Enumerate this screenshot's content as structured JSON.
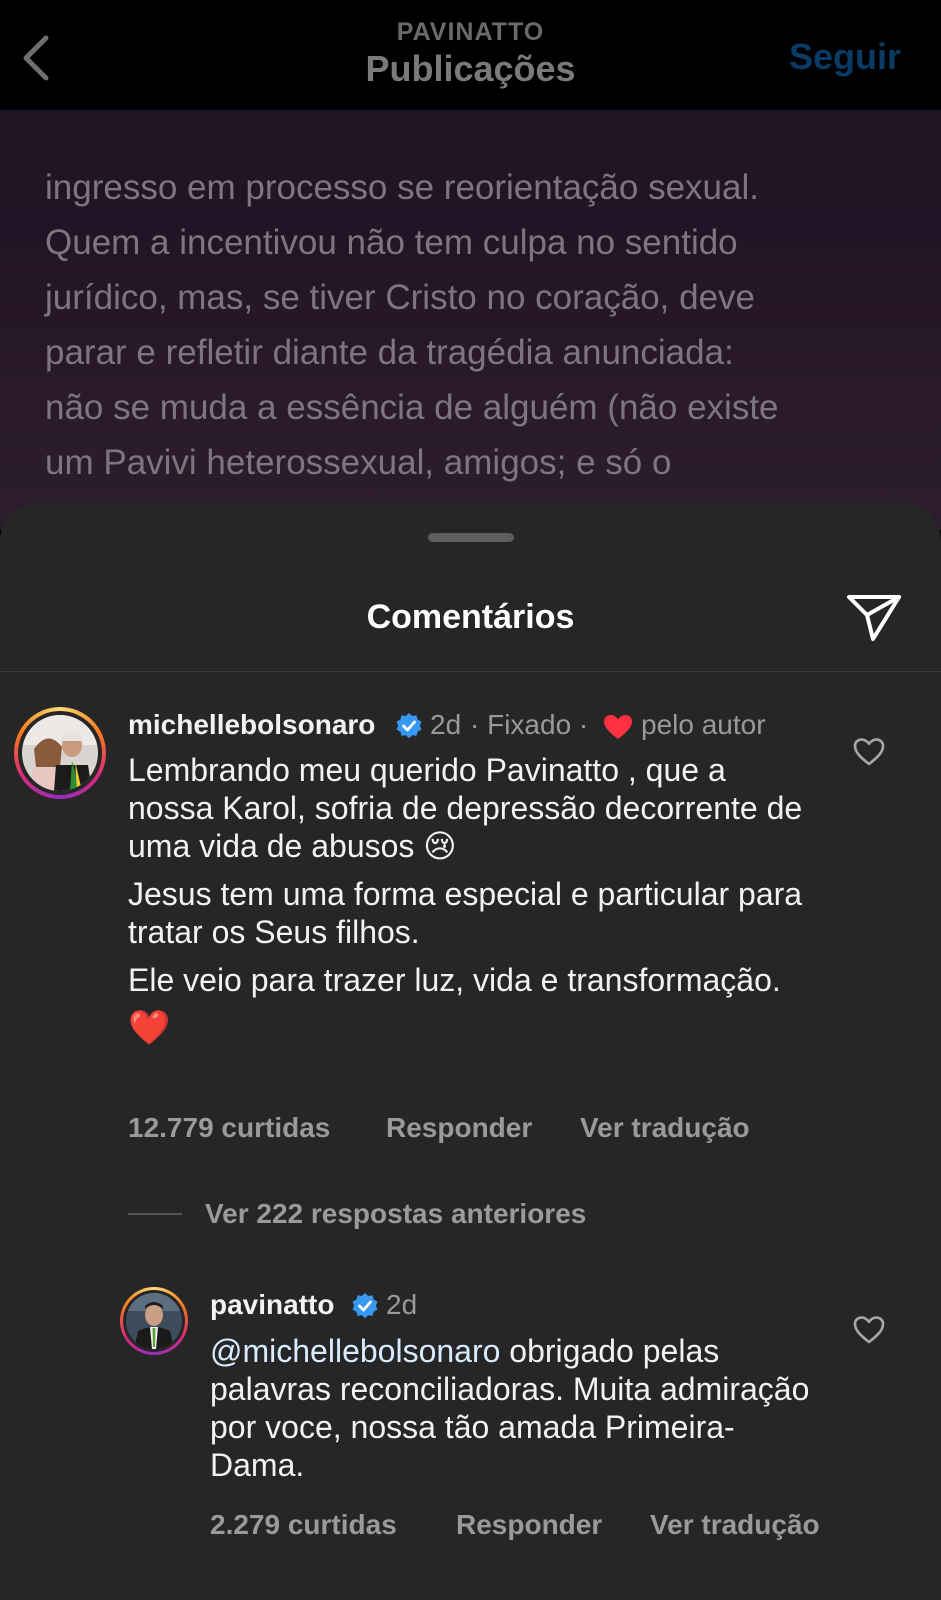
{
  "header": {
    "subtitle": "PAVINATTO",
    "title": "Publicações",
    "follow_label": "Seguir"
  },
  "post": {
    "text": "ingresso em processo se reorientação sexual.\nQuem a incentivou não tem culpa no sentido\njurídico, mas, se tiver Cristo no coração, deve\nparar e refletir diante da tragédia anunciada:\nnão se muda a essência de alguém (não existe\num Pavivi heterossexual, amigos; e só o\n"
  },
  "comments_sheet": {
    "title": "Comentários",
    "pinned_comment": {
      "username": "michellebolsonaro",
      "time": "2d",
      "pinned_label": "· Fixado ·",
      "liked_by_author_label": "pelo autor",
      "paragraphs": [
        "Lembrando meu querido Pavinatto , que a nossa Karol, sofria de depressão decorrente de uma vida de abusos 😢",
        "Jesus tem uma forma especial e particular para tratar os Seus filhos.",
        "Ele veio para trazer luz, vida e transformação.",
        "❤️"
      ],
      "likes": "12.779 curtidas",
      "reply_label": "Responder",
      "translate_label": "Ver tradução"
    },
    "view_replies_label": "Ver 222 respostas anteriores",
    "reply_comment": {
      "username": "pavinatto",
      "time": "2d",
      "mention": "@michellebolsonaro",
      "text": " obrigado pelas palavras reconciliadoras. Muita admiração por voce, nossa tão amada Primeira-Dama.",
      "likes": "2.279 curtidas",
      "reply_label": "Responder",
      "translate_label": "Ver tradução"
    }
  },
  "colors": {
    "sheet_bg": "#262626",
    "verified_blue": "#3897f0",
    "heart_red": "#ff3040",
    "follow_blue": "#0a3a66"
  }
}
